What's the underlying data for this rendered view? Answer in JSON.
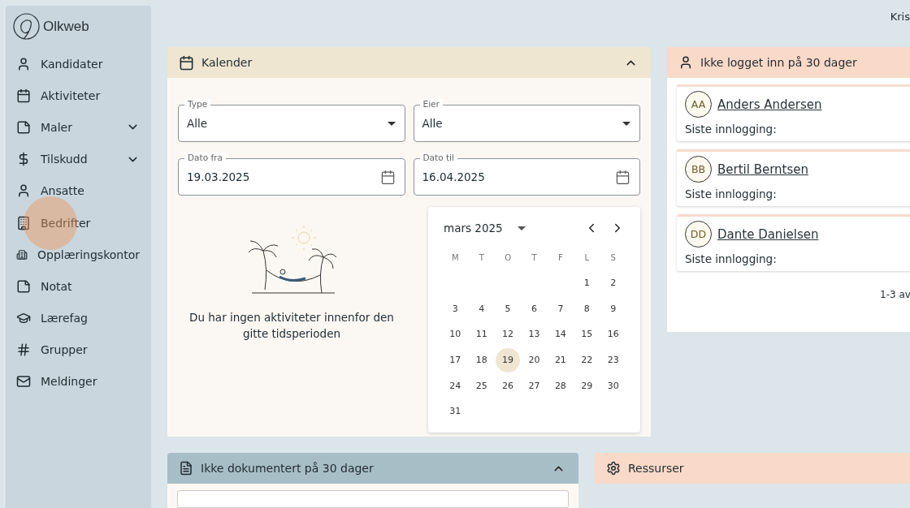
{
  "app": {
    "name": "Olkweb"
  },
  "sidebar": {
    "items": [
      {
        "label": "Kandidater",
        "click_marker": false
      },
      {
        "label": "Aktiviteter",
        "click_marker": false
      },
      {
        "label": "Maler",
        "expanded": false,
        "click_marker": false
      },
      {
        "label": "Tilskudd",
        "expanded": false,
        "click_marker": false
      },
      {
        "label": "Ansatte",
        "click_marker": false
      },
      {
        "label": "Bedrifter",
        "click_marker": true
      },
      {
        "label": "Opplæringskontor",
        "click_marker": false
      },
      {
        "label": "Notat",
        "click_marker": false
      },
      {
        "label": "Lærefag",
        "click_marker": false
      },
      {
        "label": "Grupper",
        "click_marker": false
      },
      {
        "label": "Meldinger",
        "click_marker": false
      }
    ]
  },
  "top_bar": {
    "user": "Kris"
  },
  "calendar_card": {
    "title": "Kalender",
    "expanded": true,
    "fields": [
      {
        "kind": "select",
        "label": "Type",
        "value": "Alle"
      },
      {
        "kind": "select",
        "label": "Eier",
        "value": "Alle"
      },
      {
        "kind": "date",
        "label": "Dato fra",
        "value": "19.03.2025"
      },
      {
        "kind": "date",
        "label": "Dato til",
        "value": "16.04.2025"
      }
    ],
    "empty_message": "Du har ingen aktiviteter innenfor den gitte tidsperioden",
    "picker": {
      "month": "mars 2025",
      "weekdays": [
        "M",
        "T",
        "O",
        "T",
        "F",
        "L",
        "S"
      ],
      "weeks": [
        [
          {
            "day": "1",
            "selected": false
          },
          {
            "day": "2",
            "selected": false
          }
        ],
        [
          {
            "day": "3",
            "selected": false
          },
          {
            "day": "4",
            "selected": false
          },
          {
            "day": "5",
            "selected": false
          },
          {
            "day": "6",
            "selected": false
          },
          {
            "day": "7",
            "selected": false
          },
          {
            "day": "8",
            "selected": false
          },
          {
            "day": "9",
            "selected": false
          }
        ],
        [
          {
            "day": "10",
            "selected": false
          },
          {
            "day": "11",
            "selected": false
          },
          {
            "day": "12",
            "selected": false
          },
          {
            "day": "13",
            "selected": false
          },
          {
            "day": "14",
            "selected": false
          },
          {
            "day": "15",
            "selected": false
          },
          {
            "day": "16",
            "selected": false
          }
        ],
        [
          {
            "day": "17",
            "selected": false
          },
          {
            "day": "18",
            "selected": false
          },
          {
            "day": "19",
            "selected": true
          },
          {
            "day": "20",
            "selected": false
          },
          {
            "day": "21",
            "selected": false
          },
          {
            "day": "22",
            "selected": false
          },
          {
            "day": "23",
            "selected": false
          }
        ],
        [
          {
            "day": "24",
            "selected": false
          },
          {
            "day": "25",
            "selected": false
          },
          {
            "day": "26",
            "selected": false
          },
          {
            "day": "27",
            "selected": false
          },
          {
            "day": "28",
            "selected": false
          },
          {
            "day": "29",
            "selected": false
          },
          {
            "day": "30",
            "selected": false
          }
        ],
        [
          {
            "day": "31",
            "selected": false
          }
        ]
      ]
    }
  },
  "login_card": {
    "title": "Ikke logget inn på 30 dager",
    "people": [
      {
        "initials": "AA",
        "name": "Anders Andersen",
        "last_login_label": "Siste innlogging:"
      },
      {
        "initials": "BB",
        "name": "Bertil Berntsen",
        "last_login_label": "Siste innlogging:"
      },
      {
        "initials": "DD",
        "name": "Dante Danielsen",
        "last_login_label": "Siste innlogging:"
      }
    ],
    "pagination": "1-3 av"
  },
  "undocumented_card": {
    "title": "Ikke dokumentert på 30 dager",
    "expanded": true
  },
  "resources_card": {
    "title": "Ressurser"
  }
}
